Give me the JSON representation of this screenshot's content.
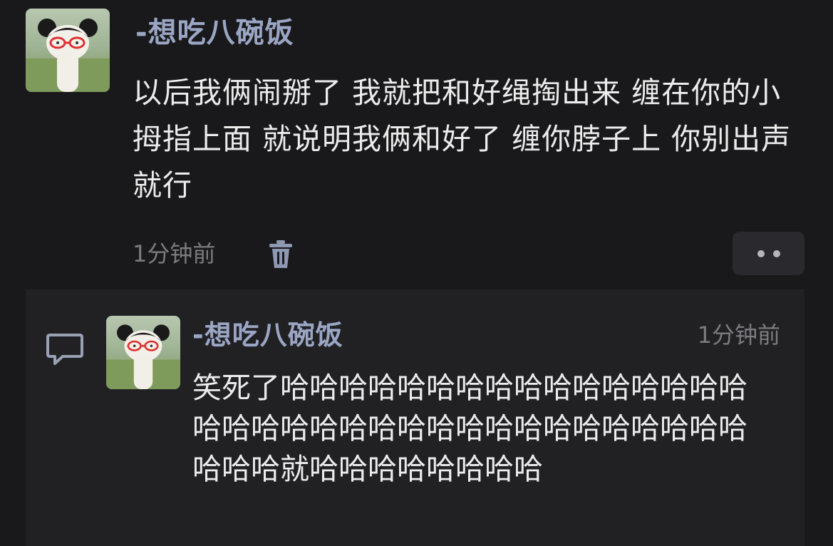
{
  "post": {
    "author": "-想吃八碗饭",
    "content": "以后我俩闹掰了 我就把和好绳掏出来 缠在你的小拇指上面 就说明我俩和好了 缠你脖子上 你别出声就行",
    "time": "1分钟前",
    "avatar_icon": "avatar-image",
    "delete_icon": "trash-icon",
    "more_icon": "more-dots-icon"
  },
  "reply": {
    "author": "-想吃八碗饭",
    "time": "1分钟前",
    "content": "笑死了哈哈哈哈哈哈哈哈哈哈哈哈哈哈哈哈哈哈哈哈哈哈哈哈哈哈哈哈哈哈哈哈哈哈哈哈哈哈就哈哈哈哈哈哈哈哈",
    "reply_icon": "comment-icon"
  },
  "colors": {
    "background": "#19191b",
    "reply_panel": "#212124",
    "author": "#9aa6c4",
    "muted": "#7b7b80",
    "text": "#ececec"
  }
}
